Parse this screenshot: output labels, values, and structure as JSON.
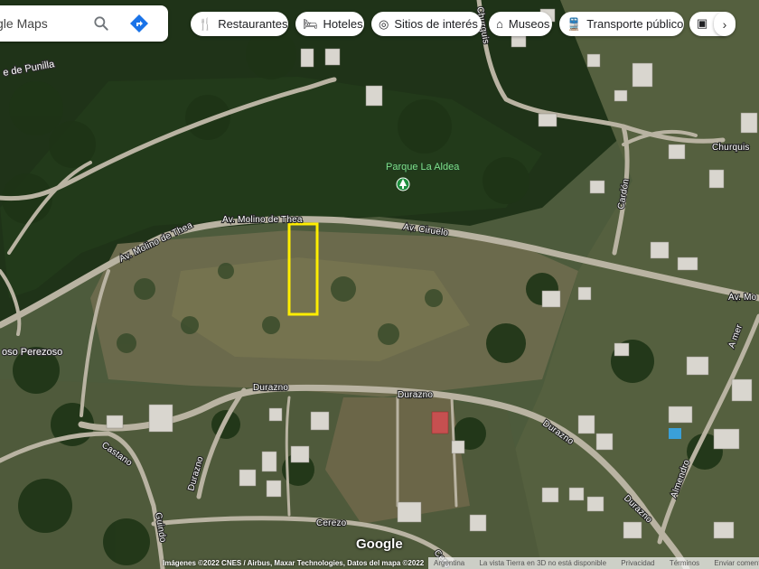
{
  "search": {
    "value": "gle Maps",
    "search_icon": "search-icon",
    "directions_icon": "directions-icon"
  },
  "chips": [
    {
      "label": "Restaurantes",
      "icon": "utensils-icon"
    },
    {
      "label": "Hoteles",
      "icon": "bed-icon"
    },
    {
      "label": "Sitios de interés",
      "icon": "camera-icon"
    },
    {
      "label": "Museos",
      "icon": "museum-icon"
    },
    {
      "label": "Transporte público",
      "icon": "train-icon"
    }
  ],
  "chips_more_icon": "chevron-right-icon",
  "map_labels": {
    "top_left": "e de Punilla",
    "park": "Parque La Aldea",
    "molino1": "Av. Molino de Thea",
    "molino2": "Av. Molino de Thea",
    "ciruelo": "Av. Ciruelo",
    "chrrucus": "Churquis",
    "churquis_right": "Churquis",
    "cardon": "Cardón",
    "av_mo": "Av. Mo",
    "oso_perezoso": "oso Perezoso",
    "durazno1": "Durazno",
    "durazno2": "Durazno",
    "durazno3": "Durazno",
    "durazno4": "Durazno",
    "durazno5": "Durazno",
    "castano": "Castano",
    "guindo": "Guindo",
    "cerezo": "Cerezo",
    "almendro": "Almendro",
    "a_mer": "A mer",
    "cer_bottom": "Cere"
  },
  "highlight_color": "#ffee00",
  "footer": {
    "google": "Google",
    "attribution": "Imágenes ©2022 CNES / Airbus, Maxar Technologies, Datos del mapa ©2022",
    "argentina": "Argentina",
    "view3d": "La vista Tierra en 3D no está disponible",
    "privacy": "Privacidad",
    "terms": "Términos",
    "feedback": "Enviar comentarios"
  }
}
